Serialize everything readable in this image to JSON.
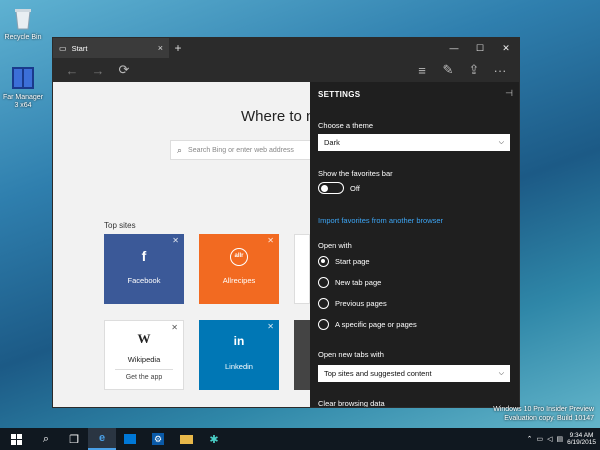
{
  "desktop": {
    "icons": [
      {
        "label": "Recycle Bin"
      },
      {
        "label": "Far Manager 3 x64"
      }
    ]
  },
  "window": {
    "tab_title": "Start",
    "tab_close": "×",
    "new_tab": "+",
    "controls": {
      "minimize": "—",
      "maximize": "☐",
      "close": "✕"
    },
    "toolbar": {
      "back": "←",
      "forward": "→",
      "refresh": "⟳",
      "hub": "≡",
      "note": "✎",
      "share": "⇪",
      "more": "···"
    }
  },
  "start_page": {
    "heading": "Where to n",
    "search_placeholder": "Search Bing or enter web address",
    "top_sites_label": "Top sites",
    "tiles": [
      {
        "name": "Facebook",
        "icon": "f",
        "color": "#3b5998"
      },
      {
        "name": "Allrecipes",
        "icon": "allr",
        "color": "#f26a21"
      },
      {
        "name": "Wikipedia",
        "icon": "W",
        "sub": "Get the app",
        "color": "#ffffff"
      },
      {
        "name": "Linkedin",
        "icon": "in",
        "color": "#0077b5"
      }
    ]
  },
  "settings": {
    "title": "SETTINGS",
    "pin_icon": "⊣",
    "theme_label": "Choose a theme",
    "theme_value": "Dark",
    "favorites_bar_label": "Show the favorites bar",
    "favorites_bar_state": "Off",
    "import_link": "Import favorites from another browser",
    "open_with_label": "Open with",
    "open_with_options": [
      "Start page",
      "New tab page",
      "Previous pages",
      "A specific page or pages"
    ],
    "open_with_selected": 0,
    "new_tabs_label": "Open new tabs with",
    "new_tabs_value": "Top sites and suggested content",
    "clear_label": "Clear browsing data"
  },
  "taskbar": {
    "start_icon": "windows-logo-icon",
    "time": "9:34 AM",
    "date": "6/19/2015"
  },
  "watermark": {
    "line1": "Windows 10 Pro Insider Preview",
    "line2": "Evaluation copy. Build 10147"
  }
}
